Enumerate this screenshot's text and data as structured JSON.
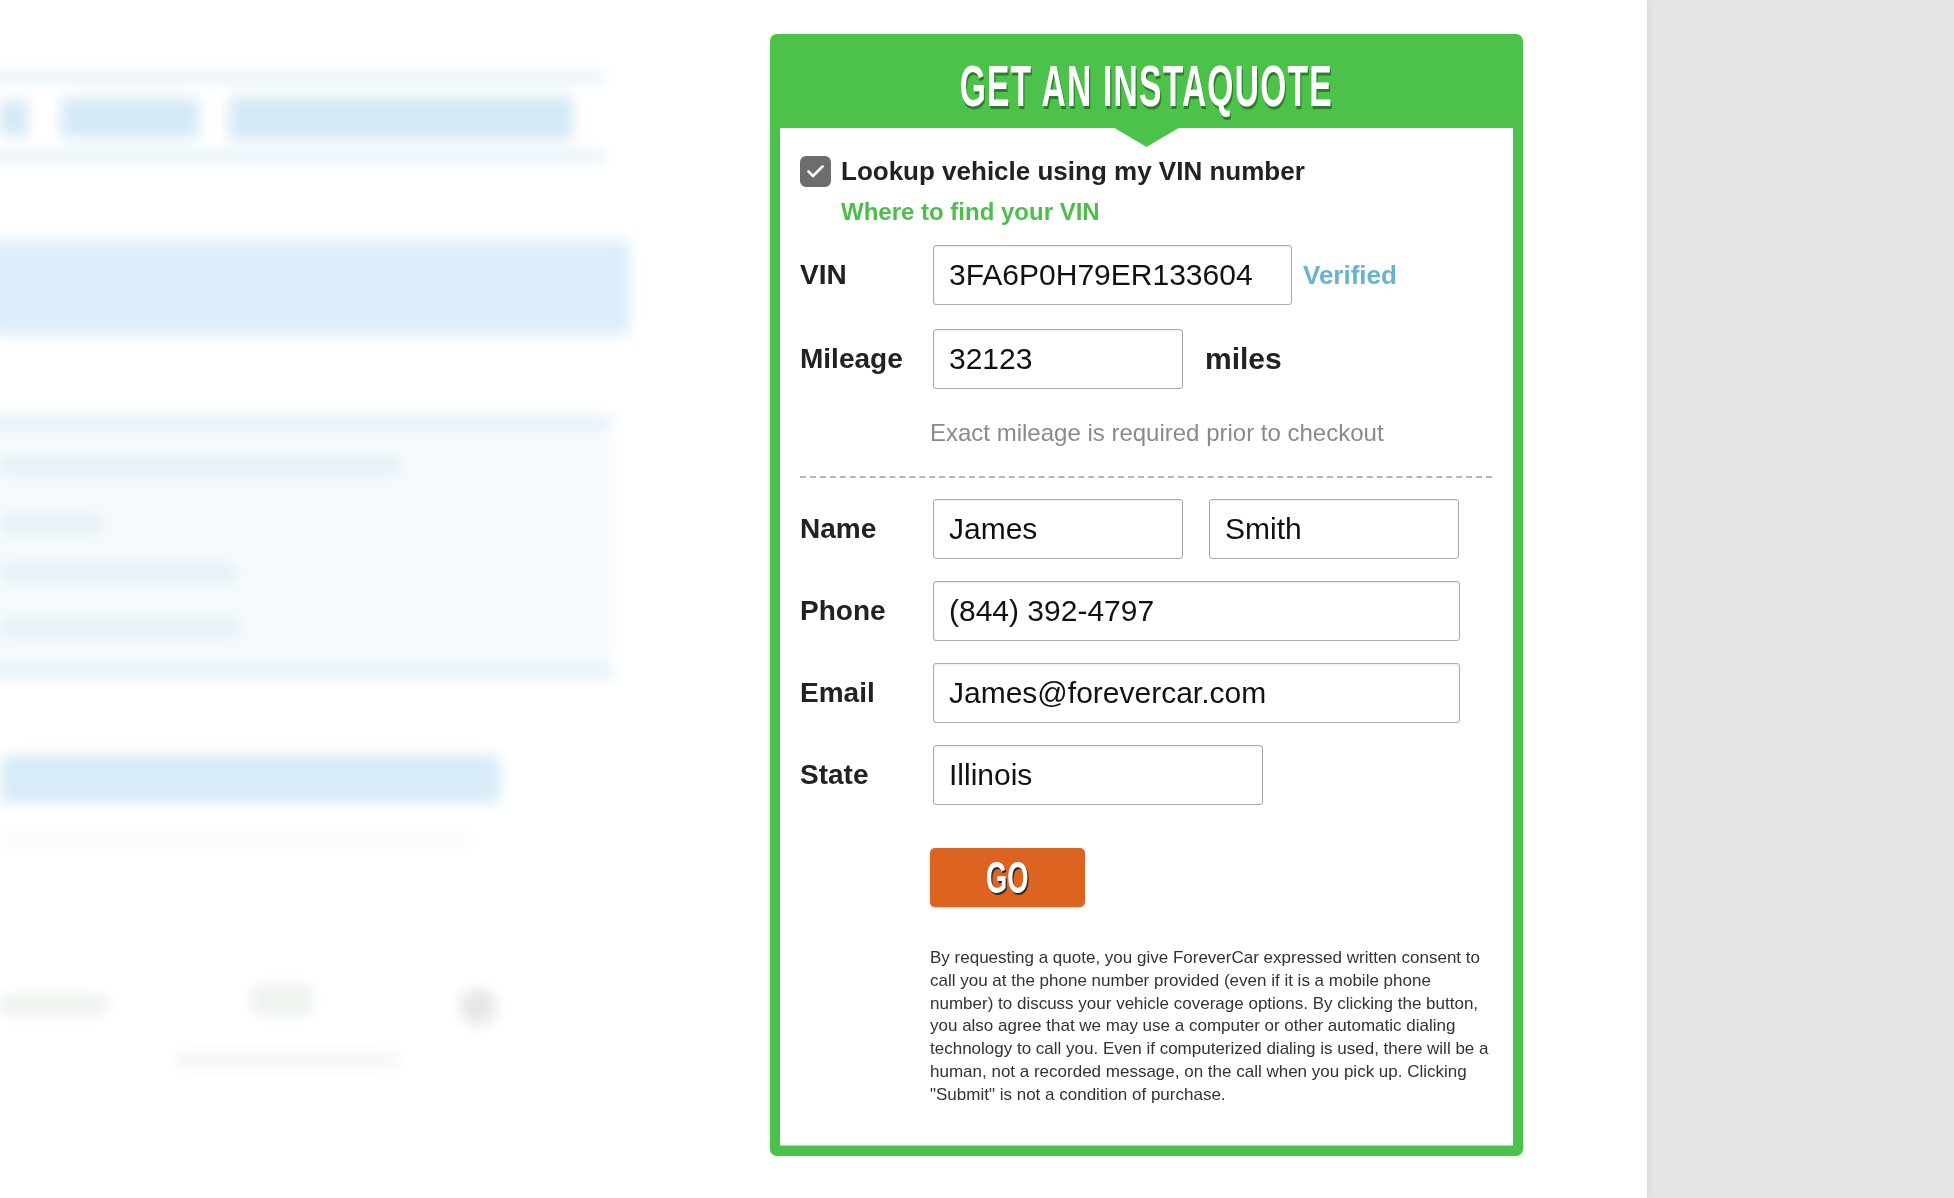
{
  "quote_form": {
    "title": "GET AN INSTAQUOTE",
    "vin_lookup": {
      "label": "Lookup vehicle using my VIN number",
      "checked": true
    },
    "vin_help_link": "Where to find your VIN",
    "vehicle_fields": [
      {
        "kind": "vin",
        "label": "VIN",
        "values": [
          "3FA6P0H79ER133604"
        ],
        "status": "Verified"
      },
      {
        "kind": "mileage",
        "label": "Mileage",
        "values": [
          "32123"
        ],
        "unit": "miles"
      }
    ],
    "mileage_note": "Exact mileage is required prior to checkout",
    "contact_fields": [
      {
        "kind": "name",
        "label": "Name",
        "values": [
          "James",
          "Smith"
        ]
      },
      {
        "kind": "phone",
        "label": "Phone",
        "values": [
          "(844) 392-4797"
        ]
      },
      {
        "kind": "email",
        "label": "Email",
        "values": [
          "James@forevercar.com"
        ]
      },
      {
        "kind": "state",
        "label": "State",
        "values": [
          "Illinois"
        ]
      }
    ],
    "submit_button": "GO",
    "disclaimer": "By requesting a quote, you give ForeverCar expressed written consent to call you at the phone number provided (even if it is a mobile phone number) to discuss your vehicle coverage options. By clicking the button, you also agree that we may use a computer or other automatic dialing technology to call you. Even if computerized dialing is used, there will be a human, not a recorded message, on the call when you pick up. Clicking \"Submit\" is not a condition of purchase."
  }
}
